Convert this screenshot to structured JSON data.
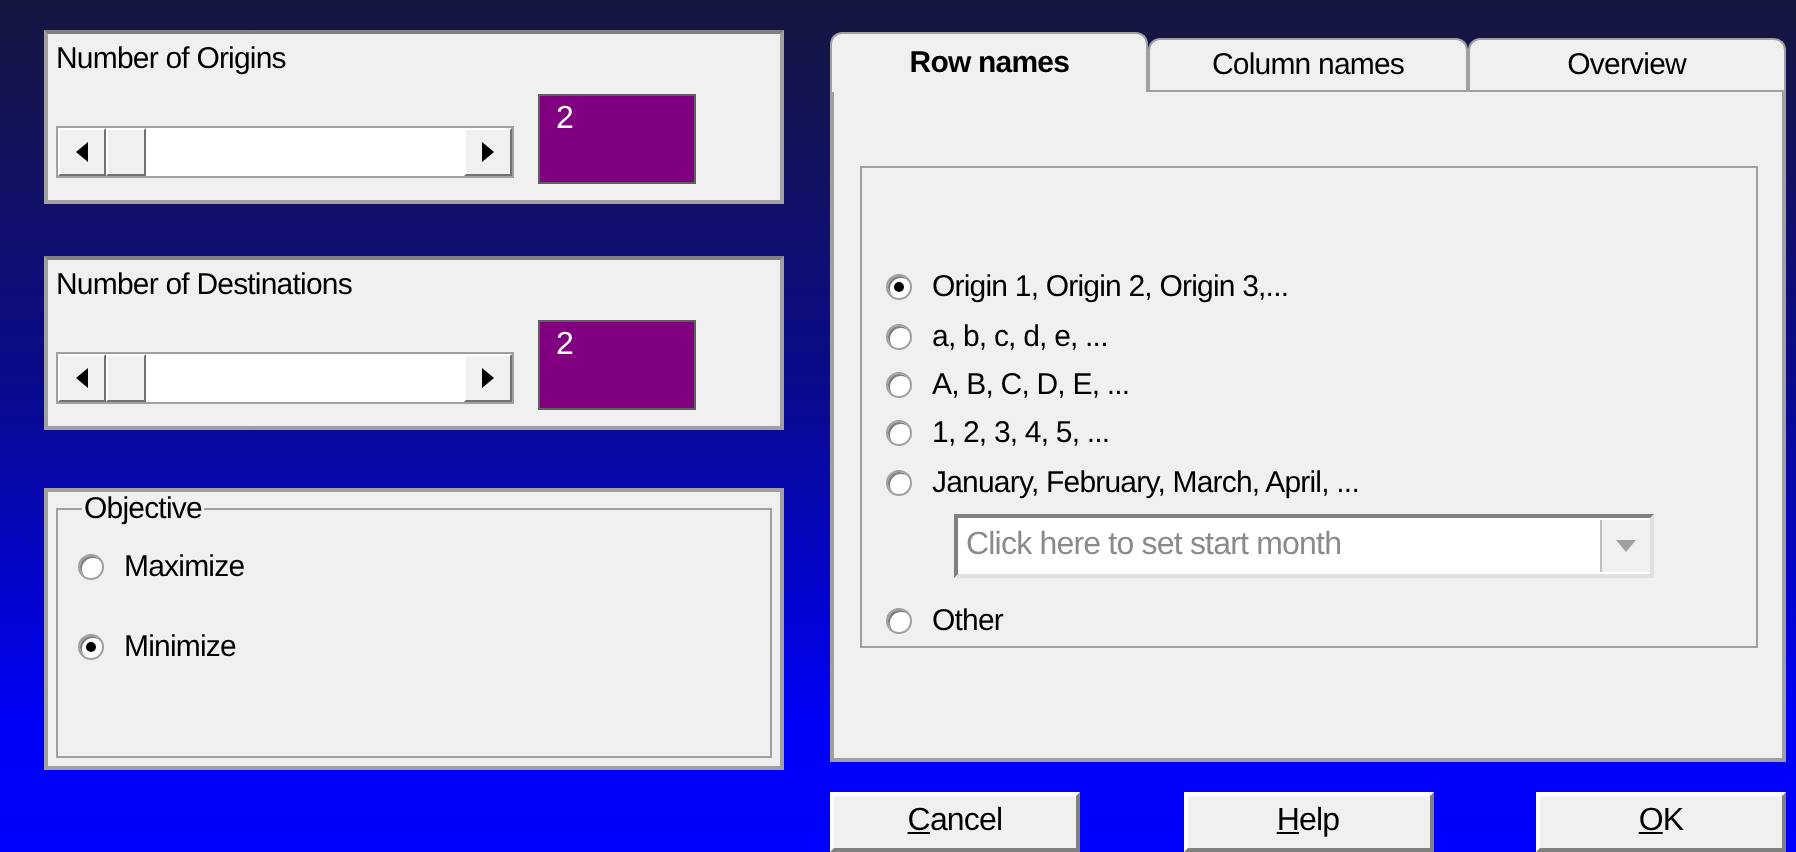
{
  "sliders": [
    {
      "label": "Number of Origins",
      "level": 0,
      "value": "2"
    },
    {
      "label": "Number of Destinations",
      "level": 0,
      "value": "2"
    }
  ],
  "objective": {
    "title": "Objective",
    "options": [
      {
        "label": "Maximize",
        "selected": false
      },
      {
        "label": "Minimize",
        "selected": true
      }
    ]
  },
  "tabs": [
    {
      "label": "Row names",
      "selected": true
    },
    {
      "label": "Column names",
      "selected": false
    },
    {
      "label": "Overview",
      "selected": false
    }
  ],
  "row_name_options": [
    {
      "kind": "radio",
      "label": "Origin 1, Origin 2, Origin 3,...",
      "selected": true
    },
    {
      "kind": "radio",
      "label": "a, b, c, d, e, ...",
      "selected": false
    },
    {
      "kind": "radio",
      "label": "A, B, C, D, E, ...",
      "selected": false
    },
    {
      "kind": "radio",
      "label": "1, 2, 3, 4, 5, ...",
      "selected": false
    },
    {
      "kind": "radio",
      "label": "January, February, March, April, ...",
      "selected": false
    },
    {
      "kind": "dropdown",
      "placeholder": "Click here to set start month",
      "disabled": true
    },
    {
      "kind": "radio",
      "label": "Other",
      "selected": false
    }
  ],
  "buttons": [
    {
      "underlined": "C",
      "rest": "ancel"
    },
    {
      "underlined": "H",
      "rest": "elp"
    },
    {
      "underlined": "O",
      "rest": "K"
    }
  ]
}
